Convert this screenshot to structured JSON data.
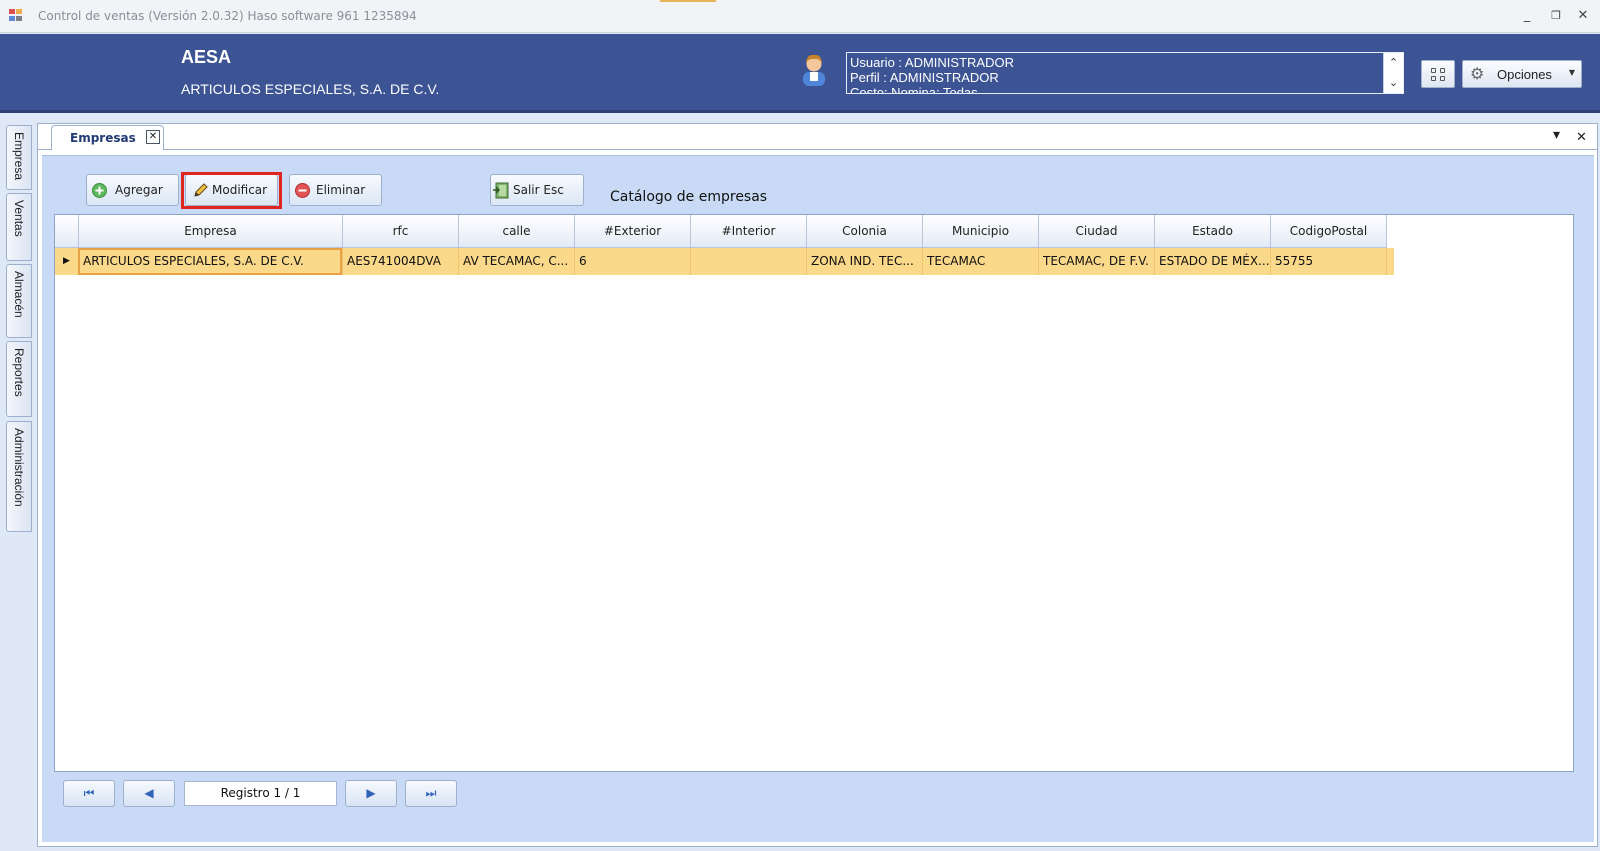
{
  "window": {
    "title": "Control de ventas  (Versión 2.0.32)  Haso software  961 1235894",
    "minimize_glyph": "_",
    "restore_glyph": "❐",
    "close_glyph": "✕"
  },
  "header": {
    "brand": "AESA",
    "company": "ARTICULOS ESPECIALES, S.A. DE C.V.",
    "user_lines": [
      "Usuario : ADMINISTRADOR",
      "Perfil : ADMINISTRADOR",
      "Costo: Nomina: Todas"
    ],
    "options_label": "Opciones",
    "scroll_up": "⌃",
    "scroll_down": "⌄",
    "options_caret": "▼"
  },
  "side_tabs": [
    "Empresa",
    "Ventas",
    "Almacén",
    "Reportes",
    "Administración"
  ],
  "document": {
    "tab_label": "Empresas",
    "tab_close": "✕",
    "menu_caret": "▾",
    "menu_close": "✕"
  },
  "toolbar": {
    "add_label": "Agregar",
    "modify_label": "Modificar",
    "delete_label": "Eliminar",
    "exit_label": "Salir  Esc",
    "catalog_title": "Catálogo de empresas"
  },
  "grid": {
    "columns": [
      "Empresa",
      "rfc",
      "calle",
      "#Exterior",
      "#Interior",
      "Colonia",
      "Municipio",
      "Ciudad",
      "Estado",
      "CodigoPostal"
    ],
    "rows": [
      [
        "ARTICULOS ESPECIALES, S.A. DE C.V.",
        "AES741004DVA",
        "AV TECAMAC, C...",
        "6",
        "",
        "ZONA IND. TEC...",
        "TECAMAC",
        "TECAMAC, DE F.V.",
        "ESTADO DE MÉX...",
        "55755"
      ]
    ],
    "row_indicator": "▶"
  },
  "navigator": {
    "record_text": "Registro  1 / 1",
    "first_glyph": "⏮",
    "prev_glyph": "◀",
    "next_glyph": "▶",
    "last_glyph": "⏭"
  },
  "colors": {
    "header_bg": "#3c5494",
    "panel_bg": "#c8daf5",
    "selected_row": "#fbd98a",
    "highlight_border": "#e02420"
  }
}
